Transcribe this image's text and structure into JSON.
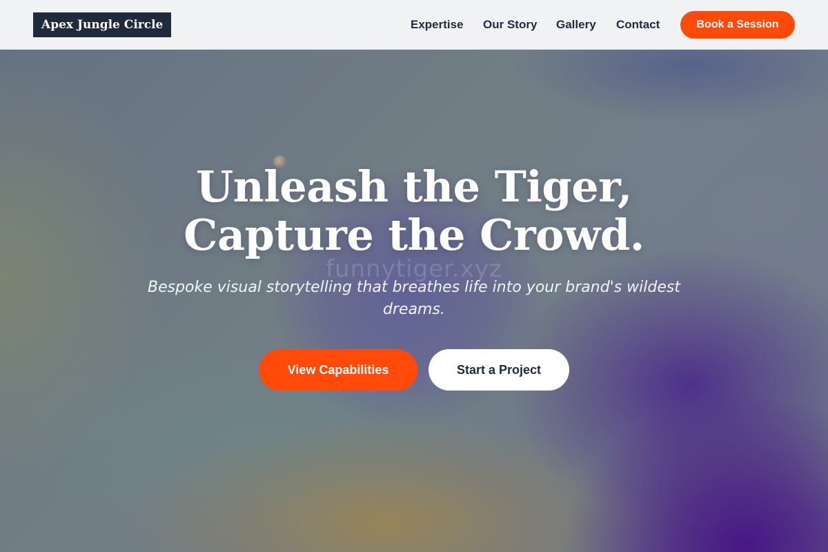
{
  "nav": {
    "logo": "Apex Jungle Circle",
    "links": [
      "Expertise",
      "Our Story",
      "Gallery",
      "Contact"
    ],
    "cta": "Book a Session"
  },
  "hero": {
    "headline_line1": "Unleash the Tiger,",
    "headline_line2": "Capture the Crowd.",
    "subtitle": "Bespoke visual storytelling that breathes life into your brand's wildest dreams.",
    "watermark": "funnytiger.xyz",
    "primary_button": "View Capabilities",
    "secondary_button": "Start a Project"
  },
  "colors": {
    "accent": "#ff4a0a",
    "nav_background": "#f1f2f4",
    "logo_background": "#1f2a3d",
    "text_dark": "#1f2a3d"
  }
}
